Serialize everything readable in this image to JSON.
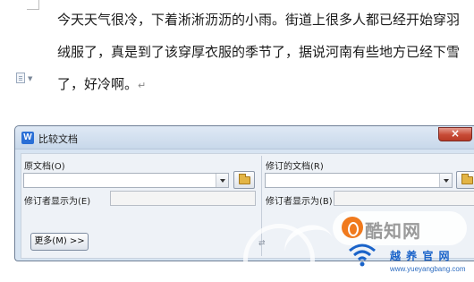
{
  "document": {
    "lines": [
      "今天天气很冷，下着淅淅沥沥的小雨。街道上很多人都已经开始穿羽",
      "绒服了，真是到了该穿厚衣服的季节了，据说河南有些地方已经下雪",
      "了，好冷啊。"
    ],
    "paragraph_mark": "↵"
  },
  "dialog": {
    "title": "比较文档",
    "app_icon_letter": "W",
    "close_label": "×",
    "original": {
      "label": "原文档(O)",
      "value": "",
      "reviser_label": "修订者显示为(E)",
      "reviser_value": ""
    },
    "revised": {
      "label": "修订的文档(R)",
      "value": "",
      "reviser_label": "修订者显示为(B)",
      "reviser_value": ""
    },
    "swap_icon": "⇄",
    "more_button": "更多(M) >>"
  },
  "watermark": {
    "logo_text": "酷知网",
    "brand": "越 养 官 网",
    "url": "www.yueyangbang.com"
  },
  "colors": {
    "titlebar": "#c8d8ea",
    "close_button": "#c74a35",
    "brand_blue": "#1a63c9",
    "logo_orange": "#f07a1e"
  }
}
